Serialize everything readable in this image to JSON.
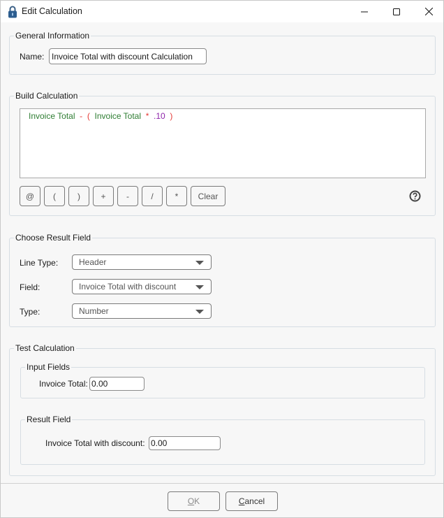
{
  "window": {
    "title": "Edit Calculation",
    "icon": "padlock-icon",
    "controls": [
      "minimize",
      "maximize",
      "close"
    ]
  },
  "general_information": {
    "legend": "General Information",
    "name_label": "Name:",
    "name_value": "Invoice Total with discount Calculation"
  },
  "build_calculation": {
    "legend": "Build Calculation",
    "formula": {
      "tokens": [
        {
          "text": "Invoice Total",
          "kind": "field"
        },
        {
          "text": "-",
          "kind": "operator"
        },
        {
          "text": "(",
          "kind": "operator"
        },
        {
          "text": "Invoice Total",
          "kind": "field"
        },
        {
          "text": "*",
          "kind": "operator"
        },
        {
          "text": ".10",
          "kind": "number"
        },
        {
          "text": ")",
          "kind": "operator"
        }
      ]
    },
    "token_colors": {
      "field": "#2e7d32",
      "operator": "#e53935",
      "number": "#8e24aa"
    },
    "operator_buttons": [
      "@",
      "(",
      ")",
      "+",
      "-",
      "/",
      "*"
    ],
    "clear_label": "Clear",
    "help_icon": "help-circle-icon"
  },
  "choose_result_field": {
    "legend": "Choose Result Field",
    "line_type_label": "Line Type:",
    "line_type_value": "Header",
    "field_label": "Field:",
    "field_value": "Invoice Total with discount",
    "type_label": "Type:",
    "type_value": "Number"
  },
  "test_calculation": {
    "legend": "Test Calculation",
    "input_fields": {
      "legend": "Input Fields",
      "invoice_total_label": "Invoice Total:",
      "invoice_total_value": "0.00"
    },
    "result_field": {
      "legend": "Result Field",
      "result_label": "Invoice Total with discount:",
      "result_value": "0.00"
    }
  },
  "footer": {
    "ok_label": "OK",
    "ok_enabled": false,
    "cancel_label": "Cancel"
  }
}
